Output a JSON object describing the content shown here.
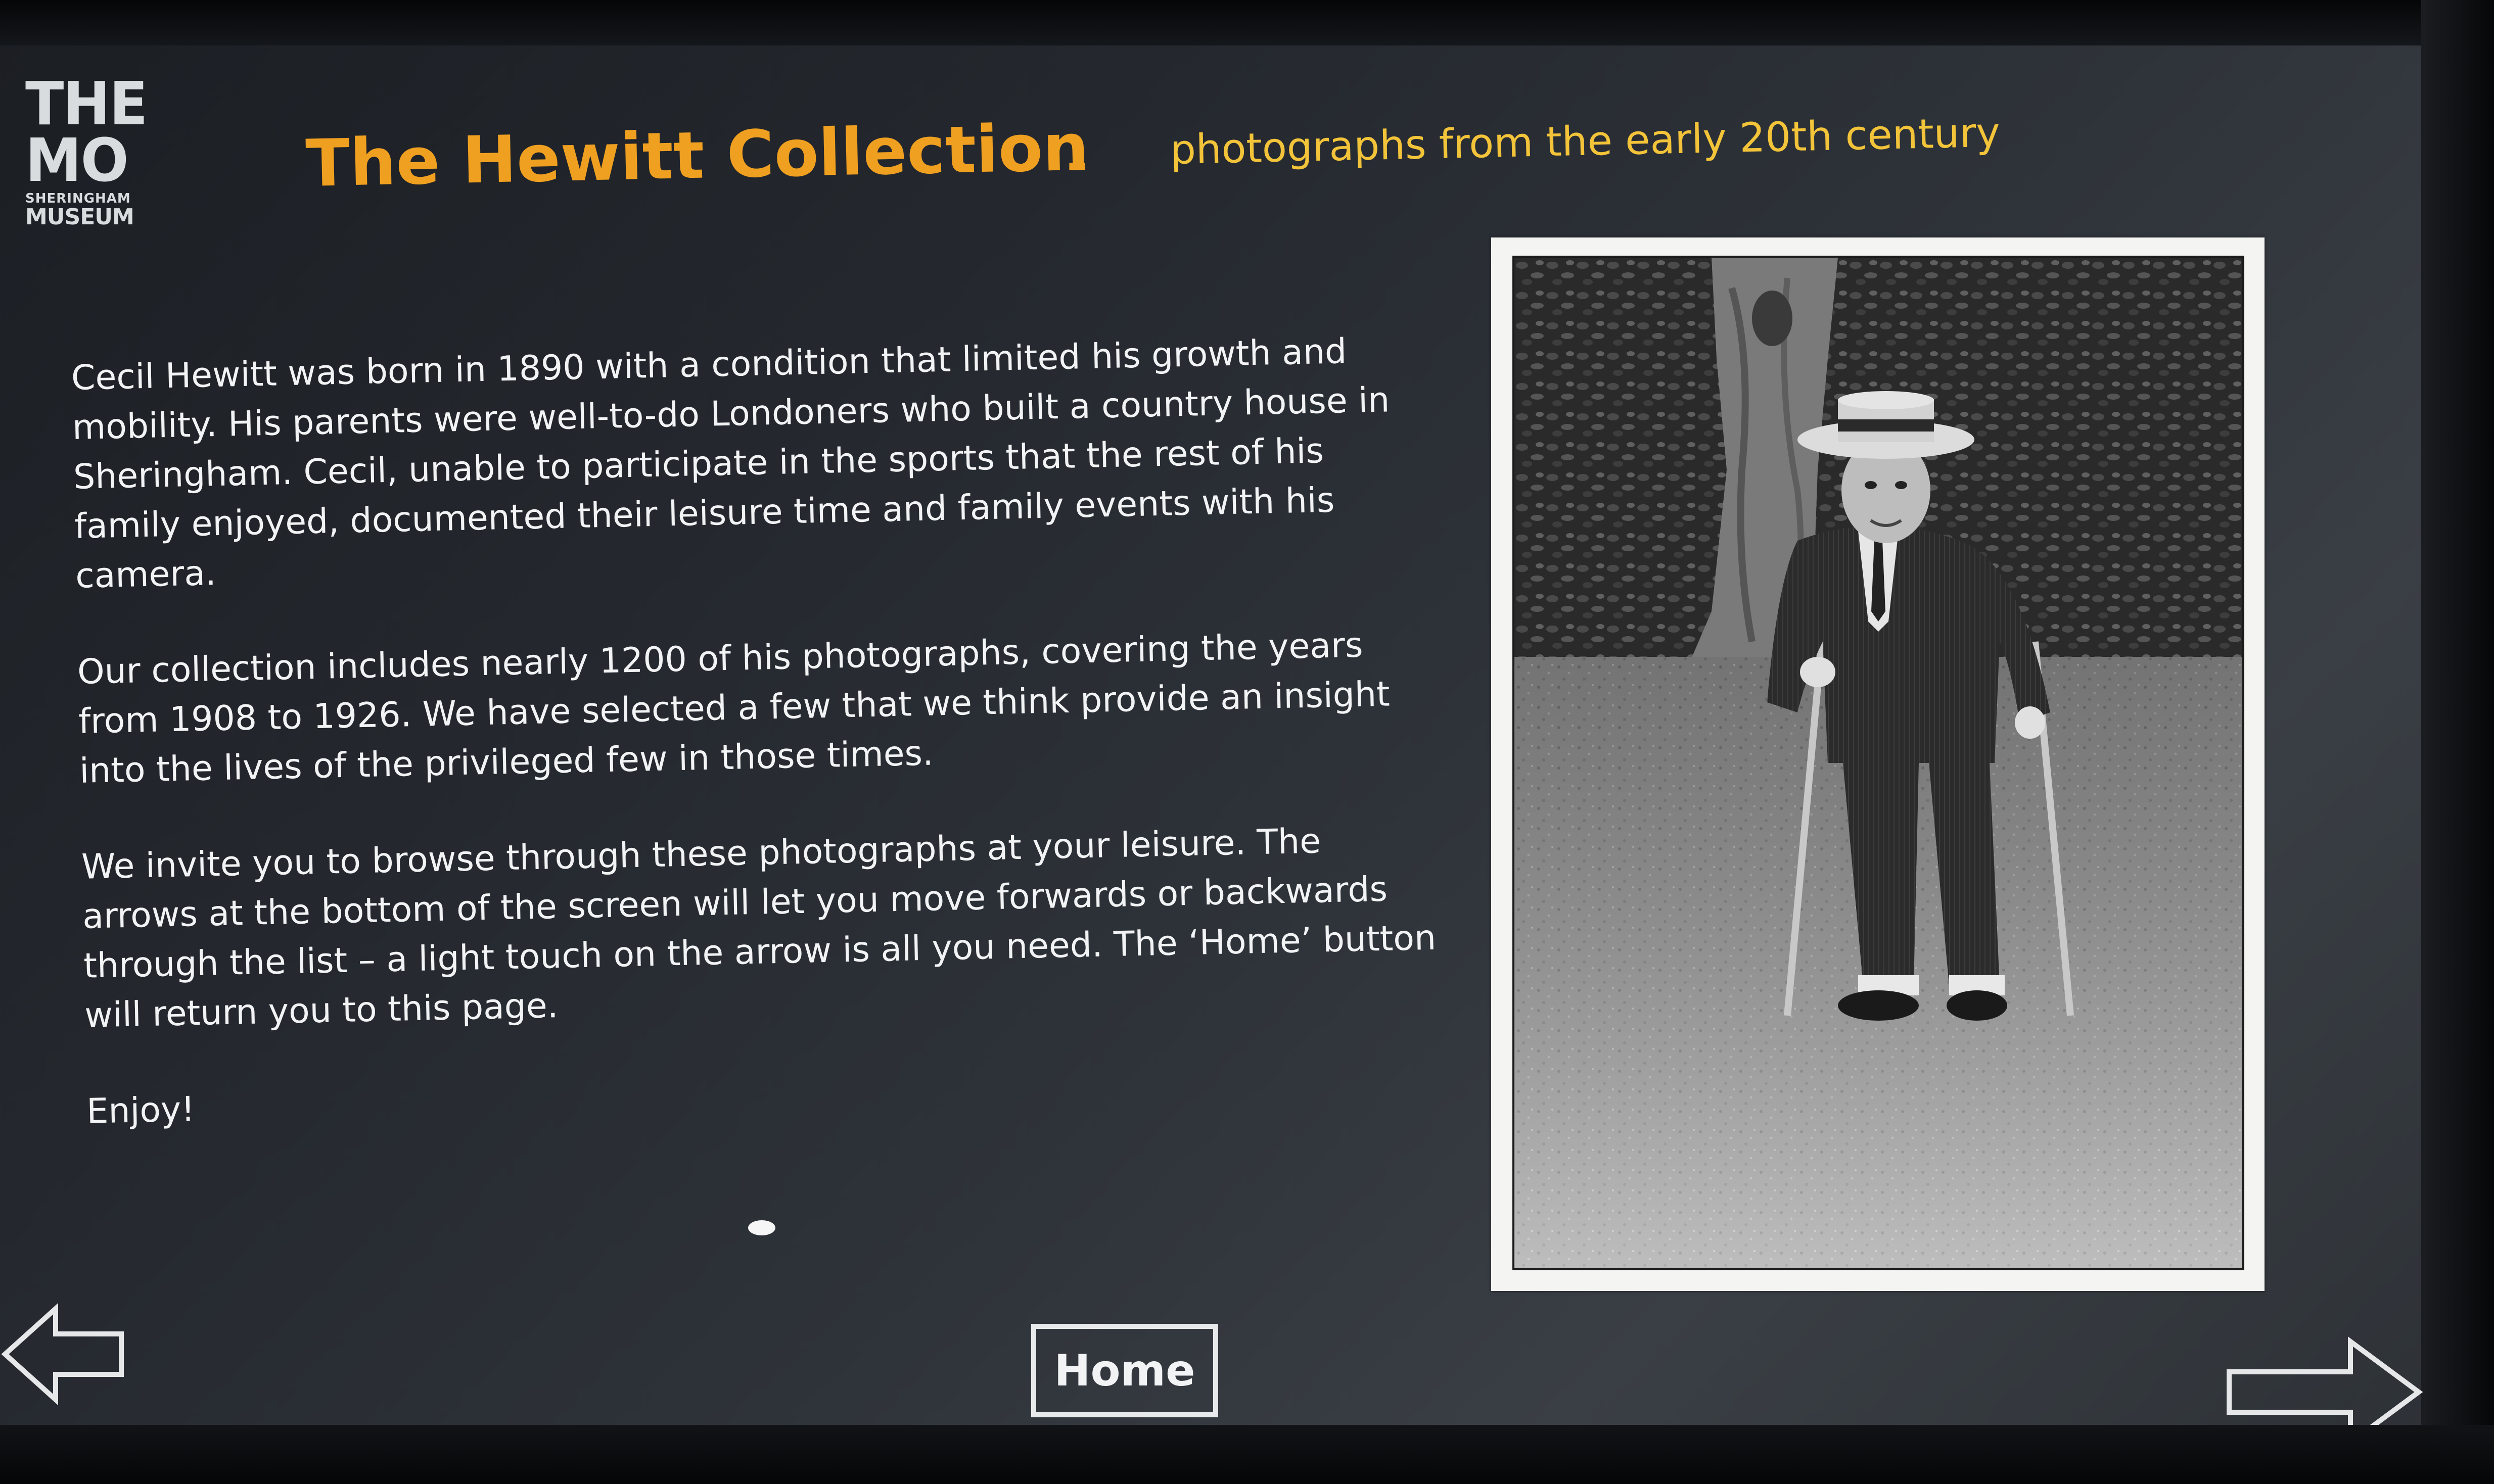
{
  "logo": {
    "line1": "THE",
    "line2": "MO",
    "line3": "SHERINGHAM",
    "line4": "MUSEUM"
  },
  "header": {
    "title": "The Hewitt Collection",
    "separator": "-",
    "subtitle": "photographs from the early 20th century"
  },
  "body": {
    "paragraph1": "Cecil Hewitt was born in 1890 with a condition that limited his growth and mobility. His parents were well-to-do Londoners who built a country house in Sheringham. Cecil, unable to participate in the sports that the rest of his family enjoyed, documented their leisure time and family events with his camera.",
    "paragraph2": "Our collection includes nearly 1200 of his photographs, covering the years from 1908 to 1926. We have selected a few that we think provide an insight into the lives of the privileged few in those times.",
    "paragraph3": "We invite you to browse through these photographs at your leisure. The arrows at the bottom of the screen will let you move forwards or backwards through the list – a light touch on the arrow is all you need. The ‘Home’ button will return you to this page.",
    "closing": "Enjoy!"
  },
  "navigation": {
    "home_label": "Home"
  },
  "icons": {
    "previous": "left-arrow-icon",
    "next": "right-arrow-icon"
  },
  "colors": {
    "title": "#f0a020",
    "subtitle": "#f3c43a",
    "text": "#f2f3f4"
  }
}
